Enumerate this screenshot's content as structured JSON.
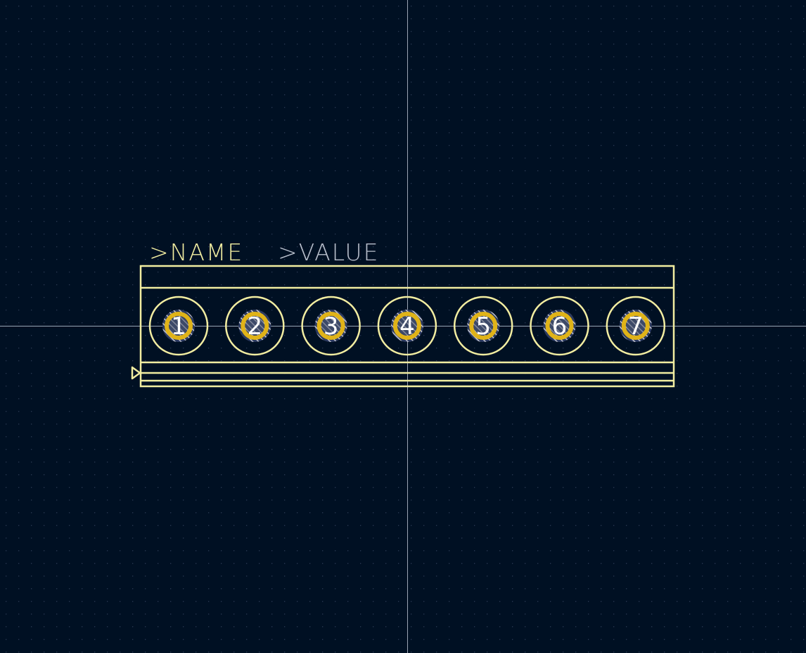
{
  "footprint": {
    "name_label": ">NAME",
    "value_label": ">VALUE",
    "pads": [
      "1",
      "2",
      "3",
      "4",
      "5",
      "6",
      "7"
    ]
  },
  "colors": {
    "background": "#001023",
    "grid_dot": "#2a3a52",
    "crosshair": "#9aa4b4",
    "silkscreen": "#f2eda1",
    "value_text": "#b9bfcc",
    "pad_copper": "#e0b318",
    "pad_drill_hatch": "#c8c8d0",
    "pad_number": "#ffffff"
  }
}
